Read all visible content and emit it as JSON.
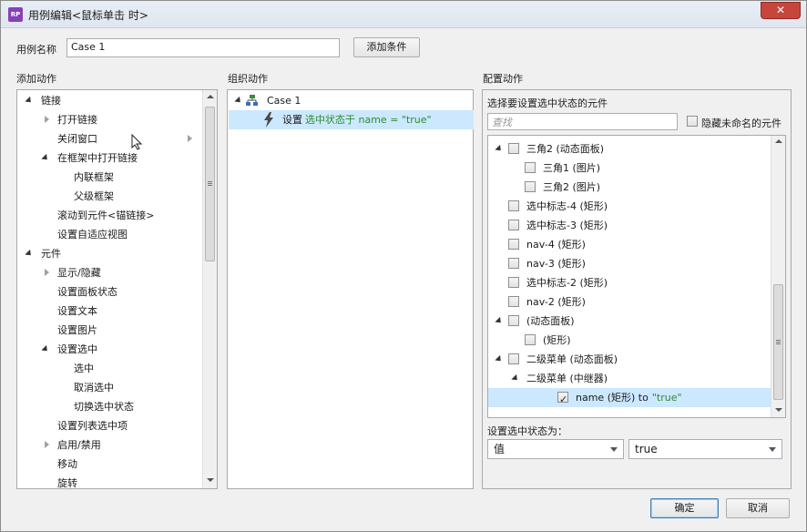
{
  "window": {
    "title": "用例编辑<鼠标单击 时>",
    "app_icon_text": "RP",
    "close_label": "✕"
  },
  "case": {
    "name_label": "用例名称",
    "name_value": "Case 1",
    "add_condition": "添加条件"
  },
  "sections": {
    "add_action": "添加动作",
    "organize_action": "组织动作",
    "configure_action": "配置动作"
  },
  "add_actions": [
    {
      "label": "链接",
      "level": 0,
      "toggle": "expanded"
    },
    {
      "label": "打开链接",
      "level": 1,
      "toggle": "collapsed"
    },
    {
      "label": "关闭窗口",
      "level": 1,
      "toggle": "none"
    },
    {
      "label": "在框架中打开链接",
      "level": 1,
      "toggle": "expanded"
    },
    {
      "label": "内联框架",
      "level": 2,
      "toggle": "none"
    },
    {
      "label": "父级框架",
      "level": 2,
      "toggle": "none"
    },
    {
      "label": "滚动到元件<锚链接>",
      "level": 1,
      "toggle": "none"
    },
    {
      "label": "设置自适应视图",
      "level": 1,
      "toggle": "none"
    },
    {
      "label": "元件",
      "level": 0,
      "toggle": "expanded"
    },
    {
      "label": "显示/隐藏",
      "level": 1,
      "toggle": "collapsed"
    },
    {
      "label": "设置面板状态",
      "level": 1,
      "toggle": "none"
    },
    {
      "label": "设置文本",
      "level": 1,
      "toggle": "none"
    },
    {
      "label": "设置图片",
      "level": 1,
      "toggle": "none"
    },
    {
      "label": "设置选中",
      "level": 1,
      "toggle": "expanded"
    },
    {
      "label": "选中",
      "level": 2,
      "toggle": "none"
    },
    {
      "label": "取消选中",
      "level": 2,
      "toggle": "none"
    },
    {
      "label": "切换选中状态",
      "level": 2,
      "toggle": "none"
    },
    {
      "label": "设置列表选中项",
      "level": 1,
      "toggle": "none"
    },
    {
      "label": "启用/禁用",
      "level": 1,
      "toggle": "collapsed"
    },
    {
      "label": "移动",
      "level": 1,
      "toggle": "none"
    },
    {
      "label": "旋转",
      "level": 1,
      "toggle": "none"
    }
  ],
  "organize": {
    "case_label": "Case 1",
    "action_prefix": "设置",
    "action_detail": "选中状态于 name = \"true\""
  },
  "configure": {
    "select_widgets_label": "选择要设置选中状态的元件",
    "search_placeholder": "查找",
    "hide_unnamed_label": "隐藏未命名的元件",
    "widgets": [
      {
        "label": "三角2 (动态面板)",
        "level": 0,
        "toggle": "expanded",
        "checked": false
      },
      {
        "label": "三角1 (图片)",
        "level": 1,
        "toggle": "none",
        "checked": false
      },
      {
        "label": "三角2 (图片)",
        "level": 1,
        "toggle": "none",
        "checked": false
      },
      {
        "label": "选中标志-4 (矩形)",
        "level": 0,
        "toggle": "none",
        "checked": false
      },
      {
        "label": "选中标志-3 (矩形)",
        "level": 0,
        "toggle": "none",
        "checked": false
      },
      {
        "label": "nav-4 (矩形)",
        "level": 0,
        "toggle": "none",
        "checked": false
      },
      {
        "label": "nav-3 (矩形)",
        "level": 0,
        "toggle": "none",
        "checked": false
      },
      {
        "label": "选中标志-2 (矩形)",
        "level": 0,
        "toggle": "none",
        "checked": false
      },
      {
        "label": "nav-2 (矩形)",
        "level": 0,
        "toggle": "none",
        "checked": false
      },
      {
        "label": "(动态面板)",
        "level": 0,
        "toggle": "expanded",
        "checked": false
      },
      {
        "label": "(矩形)",
        "level": 1,
        "toggle": "none",
        "checked": false
      },
      {
        "label": "二级菜单 (动态面板)",
        "level": 0,
        "toggle": "expanded",
        "checked": false
      },
      {
        "label": "二级菜单 (中继器)",
        "level": 1,
        "toggle": "expanded",
        "checked": null
      },
      {
        "label": "name (矩形) to",
        "value": "\"true\"",
        "level": 2,
        "toggle": "none",
        "checked": true,
        "selected": true
      }
    ],
    "set_state_label": "设置选中状态为：",
    "state_mode": "值",
    "state_value": "true"
  },
  "footer": {
    "ok": "确定",
    "cancel": "取消"
  },
  "colors": {
    "selection": "#cce8ff",
    "highlight_text": "#2c8d2c",
    "ok_border": "#3c7fb1"
  }
}
